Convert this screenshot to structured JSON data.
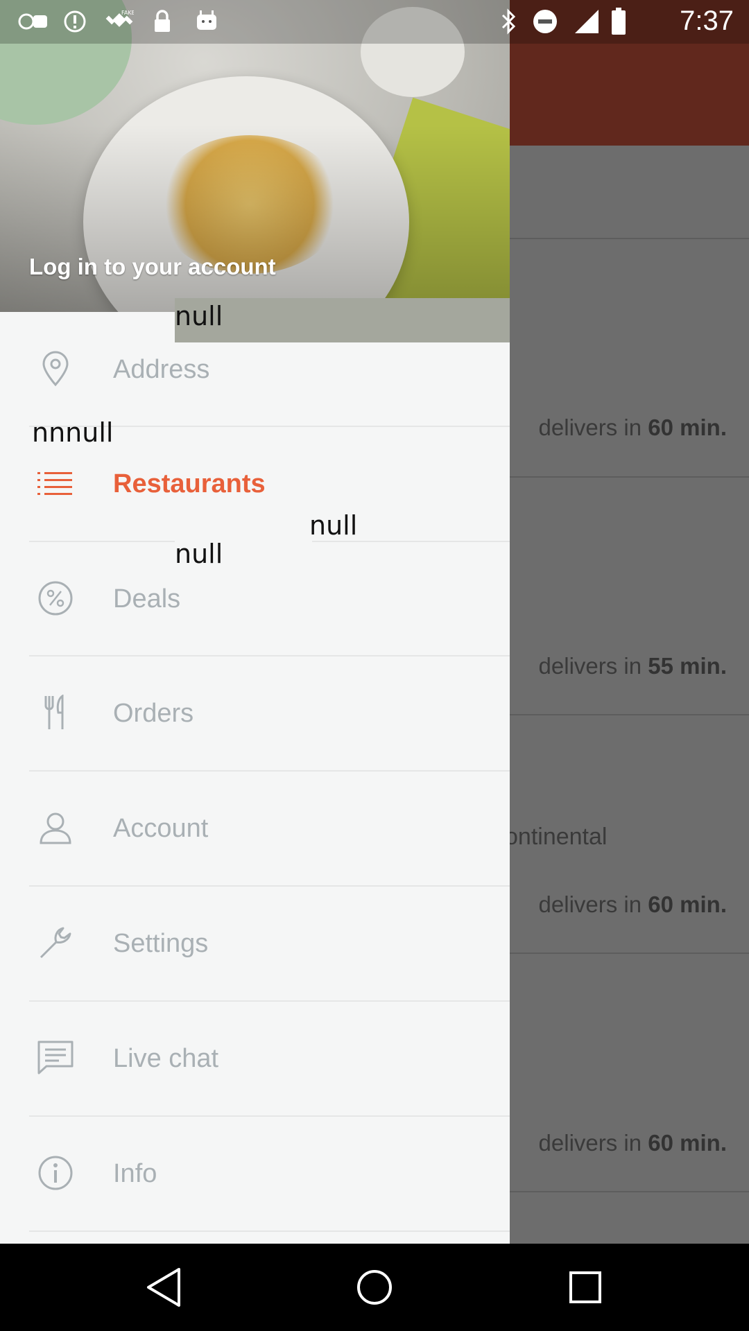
{
  "status_bar": {
    "time": "7:37",
    "left_icons": [
      "abc13-icon",
      "alert-icon",
      "fake-gps-icon",
      "lock-icon",
      "android-icon"
    ],
    "right_icons": [
      "bluetooth-icon",
      "do-not-disturb-icon",
      "signal-icon",
      "battery-icon"
    ]
  },
  "drawer": {
    "header": {
      "login_text": "Log in to your account"
    },
    "debug_labels": {
      "null_1": "null",
      "null_2": "nnnull",
      "null_3": "null",
      "null_4": "null"
    },
    "menu": [
      {
        "label": "Address",
        "icon": "location-pin-icon",
        "active": false
      },
      {
        "label": "Restaurants",
        "icon": "list-icon",
        "active": true
      },
      {
        "label": "Deals",
        "icon": "percent-icon",
        "active": false
      },
      {
        "label": "Orders",
        "icon": "fork-knife-icon",
        "active": false
      },
      {
        "label": "Account",
        "icon": "user-icon",
        "active": false
      },
      {
        "label": "Settings",
        "icon": "wrench-icon",
        "active": false
      },
      {
        "label": "Live chat",
        "icon": "chat-icon",
        "active": false
      },
      {
        "label": "Info",
        "icon": "info-icon",
        "active": false
      }
    ],
    "accent_color": "#e8603a",
    "inactive_color": "#a9b0b4"
  },
  "background_list": {
    "delivery_prefix": "delivers in",
    "rows": [
      {
        "minutes": "60 min."
      },
      {
        "minutes": "55 min."
      },
      {
        "cuisine": "ontinental",
        "minutes": "60 min."
      },
      {
        "minutes": "60 min."
      }
    ],
    "toolbar_color": "#61281d"
  },
  "nav_bar": {
    "buttons": [
      "back-icon",
      "home-icon",
      "recents-icon"
    ]
  }
}
